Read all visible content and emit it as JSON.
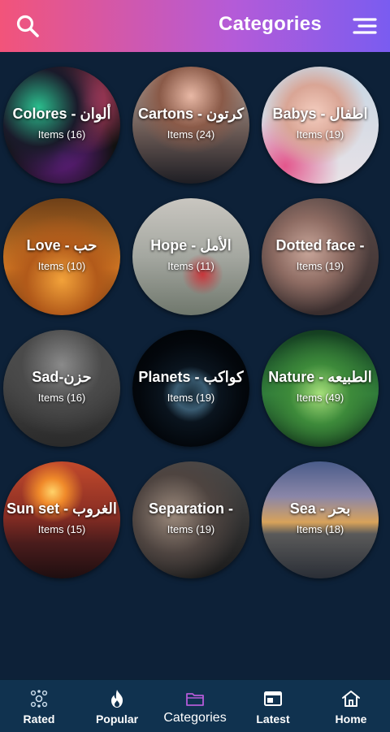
{
  "header": {
    "title": "Categories",
    "search_icon": "search-icon",
    "menu_icon": "menu-icon",
    "gradient": [
      "#f2547a",
      "#7a5cf0"
    ]
  },
  "categories": [
    {
      "name": "Colores - ألوان",
      "count": "Items (16)"
    },
    {
      "name": "Cartons - كرتون",
      "count": "Items (24)"
    },
    {
      "name": "Babys - اطفال",
      "count": "Items (19)"
    },
    {
      "name": "Love - حب",
      "count": "Items (10)"
    },
    {
      "name": "Hope - الأمل",
      "count": "Items (11)"
    },
    {
      "name": "Dotted face -",
      "count": "Items (19)"
    },
    {
      "name": "Sad-حزن",
      "count": "Items (16)"
    },
    {
      "name": "Planets - كواكب",
      "count": "Items (19)"
    },
    {
      "name": "Nature - الطبيعه",
      "count": "Items (49)"
    },
    {
      "name": "Sun set - الغروب",
      "count": "Items (15)"
    },
    {
      "name": "Separation -",
      "count": "Items (19)"
    },
    {
      "name": "Sea - بحر",
      "count": "Items (18)"
    }
  ],
  "bottom_nav": [
    {
      "label": "Rated",
      "icon": "rated-icon"
    },
    {
      "label": "Popular",
      "icon": "flame-icon"
    },
    {
      "label": "Categories",
      "icon": "folder-icon",
      "active": true
    },
    {
      "label": "Latest",
      "icon": "latest-icon"
    },
    {
      "label": "Home",
      "icon": "home-icon"
    }
  ],
  "colors": {
    "background": "#0d2138",
    "bottom_bar": "#10324f",
    "active_tab": "#b45bd8"
  }
}
